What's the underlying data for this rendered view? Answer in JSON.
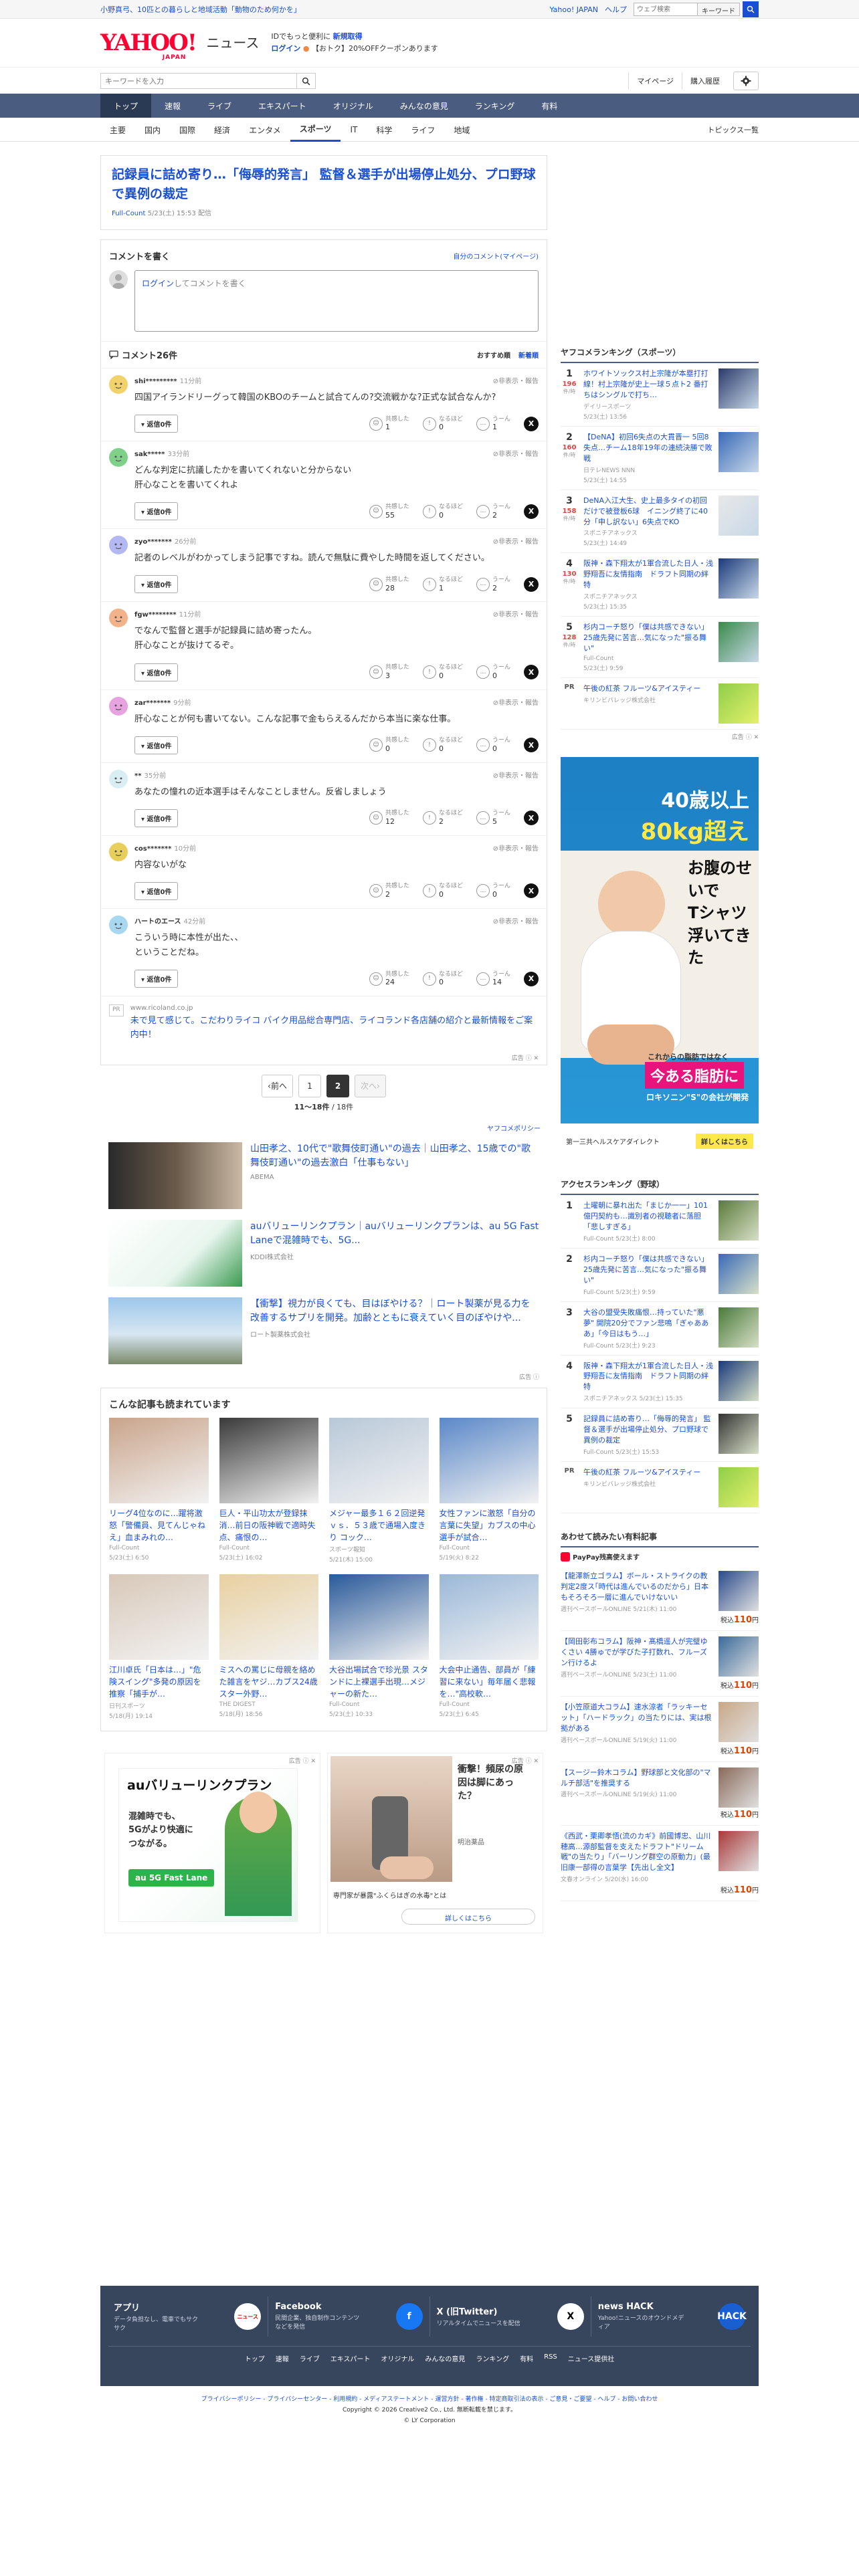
{
  "topbar": {
    "left_text": "小野真弓、10匹との暮らしと地域活動「動物のため何かを」",
    "yahoo_japan": "Yahoo! JAPAN",
    "help": "ヘルプ",
    "search_placeholder": "ウェブ検索",
    "keyword_label": "キーワード"
  },
  "header": {
    "logo": "YAHOO!",
    "logo_sub": "JAPAN",
    "section": "ニュース",
    "promo_line1a": "IDでもっと便利に",
    "promo_line1b": "新規取得",
    "promo_line2a": "ログイン",
    "promo_line2b": "【おトク】20%OFFクーポンあります"
  },
  "search": {
    "placeholder": "キーワードを入力",
    "mypage": "マイページ",
    "history": "購入履歴"
  },
  "gnav": [
    "トップ",
    "速報",
    "ライブ",
    "エキスパート",
    "オリジナル",
    "みんなの意見",
    "ランキング",
    "有料"
  ],
  "snav": {
    "items": [
      "主要",
      "国内",
      "国際",
      "経済",
      "エンタメ",
      "スポーツ",
      "IT",
      "科学",
      "ライフ",
      "地域"
    ],
    "topics": "トピックス一覧"
  },
  "article": {
    "title": "記録員に詰め寄り…「侮辱的発言」 監督＆選手が出場停止処分、プロ野球で異例の裁定",
    "source": "Full-Count",
    "date": "5/23(土) 15:53 配信"
  },
  "comment_write": {
    "title": "コメントを書く",
    "my_comments": "自分のコメント(マイページ)",
    "login": "ログイン",
    "prompt": "してコメントを書く"
  },
  "comments_header": {
    "title": "コメント26件",
    "sort_recommended": "おすすめ順",
    "sort_new": "新着順"
  },
  "reaction_labels": {
    "empathy": "共感した",
    "insight": "なるほど",
    "hmm": "うーん",
    "reply_btn": "返信0件",
    "report": "非表示・報告"
  },
  "comments": [
    {
      "user": "shi*********",
      "time": "11分前",
      "text": "四国アイランドリーグって韓国のKBOのチームと試合てんの?交流戦かな?正式な試合なんか?",
      "empathy": "1",
      "insight": "0",
      "hmm": "1",
      "color": "#f2d36b"
    },
    {
      "user": "sak*****",
      "time": "33分前",
      "text": "どんな判定に抗議したかを書いてくれないと分からない\n肝心なことを書いてくれよ",
      "empathy": "55",
      "insight": "0",
      "hmm": "2",
      "color": "#7fd18a"
    },
    {
      "user": "zyo*******",
      "time": "26分前",
      "text": "記者のレベルがわかってしまう記事ですね。読んで無駄に費やした時間を返してください。",
      "empathy": "28",
      "insight": "1",
      "hmm": "2",
      "color": "#b3b8f2"
    },
    {
      "user": "fgw********",
      "time": "11分前",
      "text": "でなんで監督と選手が記録員に詰め寄ったん。\n肝心なことが抜けてるぞ。",
      "empathy": "3",
      "insight": "0",
      "hmm": "0",
      "color": "#f2b38a"
    },
    {
      "user": "zar*******",
      "time": "9分前",
      "text": "肝心なことが何も書いてない。こんな記事で金もらえるんだから本当に楽な仕事。",
      "empathy": "0",
      "insight": "0",
      "hmm": "0",
      "color": "#e6a3e0"
    },
    {
      "user": "**",
      "time": "35分前",
      "text": "あなたの憧れの近本選手はそんなことしません。反省しましょう",
      "empathy": "12",
      "insight": "2",
      "hmm": "5",
      "color": "#d9eef2"
    },
    {
      "user": "cos*******",
      "time": "10分前",
      "text": "内容ないがな",
      "empathy": "2",
      "insight": "0",
      "hmm": "0",
      "color": "#e8cf5c"
    },
    {
      "user": "ハートのエース",
      "time": "42分前",
      "text": "こういう時に本性が出た、、\nということだね。",
      "empathy": "24",
      "insight": "0",
      "hmm": "14",
      "color": "#a8d8f0"
    }
  ],
  "inline_ad": {
    "badge": "PR",
    "url": "www.ricoland.co.jp",
    "text": "未で見て感じて。こだわりライコ バイク用品総合専門店、ライコランド各店舗の紹介と最新情報をご案内中！",
    "info": "広告"
  },
  "pager": {
    "prev": "前へ",
    "p1": "1",
    "p2": "2",
    "next": "次へ",
    "info_range": "11〜18件",
    "info_total": "/ 18件"
  },
  "policy": "ヤフコメポリシー",
  "news_rec": [
    {
      "title": "山田孝之、10代で\"歌舞伎町通い\"の過去｜山田孝之、15歳での\"歌舞伎町通い\"の過去激白「仕事もない」",
      "src": "ABEMA"
    },
    {
      "title": "auバリューリンクプラン｜auバリューリンクプランは、au 5G Fast Laneで混雑時でも、5G...",
      "src": "KDDI株式会社"
    },
    {
      "title": "【衝撃】視力が良くても、目はぼやける？｜ロート製薬が見る力を改善するサプリを開発。加齢とともに衰えていく目のぼやけや...",
      "src": "ロート製薬株式会社"
    }
  ],
  "news_rec_ad": "広告",
  "also_read": {
    "title": "こんな記事も読まれています",
    "items": [
      {
        "title": "リーグ4位なのに…躍将激怒「警備員、見てんじゃねえ」血まみれの…",
        "src": "Full-Count",
        "date": "5/23(土) 6:50"
      },
      {
        "title": "巨人・平山功太が登録抹消…前日の阪神戦で適時失点、痛恨の…",
        "src": "Full-Count",
        "date": "5/23(土) 16:02"
      },
      {
        "title": "メジャー最多１６２回逆発ｖｓ．５３歳で通場入度きり コック…",
        "src": "スポーツ報知",
        "date": "5/21(木) 15:00"
      },
      {
        "title": "女性ファンに激怒「自分の言葉に失望」カブスの中心選手が試合…",
        "src": "Full-Count",
        "date": "5/19(火) 8:22"
      },
      {
        "title": "江川卓氏「日本は…」\"危険スイング\"多発の原因を推察「捕手が…",
        "src": "日刊スポーツ",
        "date": "5/18(月) 19:14"
      },
      {
        "title": "ミスへの罵じに母親を絡めた雑言をヤジ…カブス24歳スター外野…",
        "src": "THE DIGEST",
        "date": "5/18(月) 18:56"
      },
      {
        "title": "大谷出場試合で珍光景 スタンドに上裸選手出現…メジャーの新た…",
        "src": "Full-Count",
        "date": "5/23(土) 10:33"
      },
      {
        "title": "大会中止通告、部員が「練習に来ない」毎年届く悲報を…\"高校軟…",
        "src": "Full-Count",
        "date": "5/23(土) 6:45"
      }
    ]
  },
  "bottom_ads": {
    "ad_label": "広告",
    "ad1_brand": "auバリューリンクプラン",
    "ad1_line1": "混雑時でも、",
    "ad1_line2": "5Gがより快適に",
    "ad1_line3": "つながる。",
    "ad1_tag": "au 5G Fast Lane",
    "ad2_title": "衝撃！頻尿の原因は脚にあった？",
    "ad2_brand": "明治薬品",
    "ad2_sub": "専門家が暴露\"ふくらはぎの水毒\"とは",
    "ad2_cta": "詳しくはこちら"
  },
  "ranking": {
    "title": "ヤフコメランキング（スポーツ）",
    "count_label": "件/時",
    "items": [
      {
        "rank": "1",
        "count": "196",
        "title": "ホワイトソックス村上宗隆が本塁打打線！村上宗隆が史上一球５点ト2 番打ちはシングルで打ち…",
        "src": "デイリースポーツ",
        "date": "5/23(土) 13:56"
      },
      {
        "rank": "2",
        "count": "160",
        "title": "【DeNA】初回6失点の大貫晋一 5回8失点…チーム18年19年の連続決勝で敗戦",
        "src": "日テレNEWS NNN",
        "date": "5/23(土) 14:55"
      },
      {
        "rank": "3",
        "count": "158",
        "title": "DeNA入江大生、史上最多タイの初回だけで被登板6球　イニング終了に40分「申し訳ない」6失点でKO",
        "src": "スポニチアネックス",
        "date": "5/23(土) 14:49"
      },
      {
        "rank": "4",
        "count": "130",
        "title": "阪神・森下翔太が1軍合流した日人・浅野翔吾に友情指南　ドラフト同期の絆特",
        "src": "スポニチアネックス",
        "date": "5/23(土) 15:35"
      },
      {
        "rank": "5",
        "count": "128",
        "title": "杉内コーチ怒り「僕は共感できない」 25歳先発に苦言…気になった\"振る舞い\"",
        "src": "Full-Count",
        "date": "5/23(土) 9:59"
      }
    ],
    "pr_title": "午後の紅茶 フルーツ&アイスティー",
    "pr_src": "キリンビバレッジ株式会社",
    "pr_label": "PR"
  },
  "big_ad": {
    "line1": "40歳以上",
    "line2": "80kg超え",
    "line3": "お腹のせいで",
    "line4": "Tシャツ",
    "line5": "浮いてきた",
    "line6": "これからの脂肪ではなく",
    "line7": "今ある脂肪に",
    "line8": "ロキソニン\"S\"の会社が開発",
    "brand": "第一三共ヘルスケアダイレクト",
    "cta": "詳しくはこちら",
    "ad_label": "広告"
  },
  "access_ranking": {
    "title": "アクセスランキング（野球）",
    "items": [
      {
        "rank": "1",
        "title": "土曜朝に暴れ出た「まじか一一」101億円契約も…識別者の視聴者に落胆「悲しすぎる」",
        "src": "Full-Count",
        "date": "5/23(土) 8:00"
      },
      {
        "rank": "2",
        "title": "杉内コーチ怒り「僕は共感できない」 25歳先発に苦言…気になった\"振る舞い\"",
        "src": "Full-Count",
        "date": "5/23(土) 9:59"
      },
      {
        "rank": "3",
        "title": "大谷の盟受失敗痛恨…持っていた\"悪夢\" 開院20分でファン悲鳴「ぎゃあああ」「今日はもう…」",
        "src": "Full-Count",
        "date": "5/23(土) 9:23"
      },
      {
        "rank": "4",
        "title": "阪神・森下翔太が1軍合流した日人・浅野翔吾に友情指南　ドラフト同期の絆特",
        "src": "スポニチアネックス",
        "date": "5/23(土) 15:35"
      },
      {
        "rank": "5",
        "title": "記録員に詰め寄り…「侮辱的発言」 監督＆選手が出場停止処分、プロ野球で異例の裁定",
        "src": "Full-Count",
        "date": "5/23(土) 15:53"
      }
    ],
    "pr_title": "午後の紅茶 フルーツ&アイスティー",
    "pr_src": "キリンビバレッジ株式会社",
    "pr_label": "PR"
  },
  "paid": {
    "title": "あわせて読みたい有料記事",
    "paypay": "PayPay残高使えます",
    "price_label": "税込",
    "price_value": "110",
    "price_unit": "円",
    "items": [
      {
        "title": "【龍澤新立ゴラム】ボール・ストライクの教判定2度ス｢時代は進んでいるのだから」日本もそろそろ一層に進んでいけないい",
        "src": "週刊ベースボールONLINE",
        "date": "5/21(木) 11:00"
      },
      {
        "title": "【岡田彰布コラム】阪神・髙橋遥人が完璧ゆくさい 4勝ゅでが学びた子打数れ、フルーズン行けるよ",
        "src": "週刊ベースボールONLINE",
        "date": "5/23(土) 11:00"
      },
      {
        "title": "【小笠原道大コラム】速水涼者「ラッキーセット」「ハードラック」の当たりには、実は根拠がある",
        "src": "週刊ベースボールONLINE",
        "date": "5/19(火) 11:00"
      },
      {
        "title": "【スージー鈴木コラム】野球部と文化部の\"マルチ部活\"を推奨する",
        "src": "週刊ベースボールONLINE",
        "date": "5/19(火) 11:00"
      },
      {
        "title": "《西武・栗卿孝悟(流のカギ》前國博忠、山川穂高…源部監督を支えたドラフト\"ドリーム戦\"の当たり」「バーリング群空の原動力」(最旧康一部得の言葉学【先出し全文】",
        "src": "文春オンライン",
        "date": "5/20(水) 16:00"
      }
    ]
  },
  "footer": {
    "apps": [
      {
        "name": "アプリ",
        "desc": "データ負担なし、電車でもサクサク",
        "icon": "ニュース"
      },
      {
        "name": "Facebook",
        "desc": "民間企業、独自制作コンテンツなどを発信",
        "icon": "f"
      },
      {
        "name": "X (旧Twitter)",
        "desc": "リアルタイムでニュースを配信",
        "icon": "X"
      },
      {
        "name": "news HACK",
        "desc": "Yahoo!ニュースのオウンドメディア",
        "icon": "HACK"
      }
    ],
    "links": [
      "トップ",
      "速報",
      "ライブ",
      "エキスパート",
      "オリジナル",
      "みんなの意見",
      "ランキング",
      "有料",
      "RSS",
      "ニュース提供社"
    ]
  },
  "legal": {
    "links": "プライバシーポリシー - プライバシーセンター - 利用規約 - メディアステートメント - 運営方針 - 著作権 - 特定商取引法の表示 - ご意見・ご要望 - ヘルプ - お問い合わせ",
    "copyright": "Copyright © 2026 Creative2 Co., Ltd. 無断転載を禁じます。",
    "company": "© LY Corporation"
  }
}
